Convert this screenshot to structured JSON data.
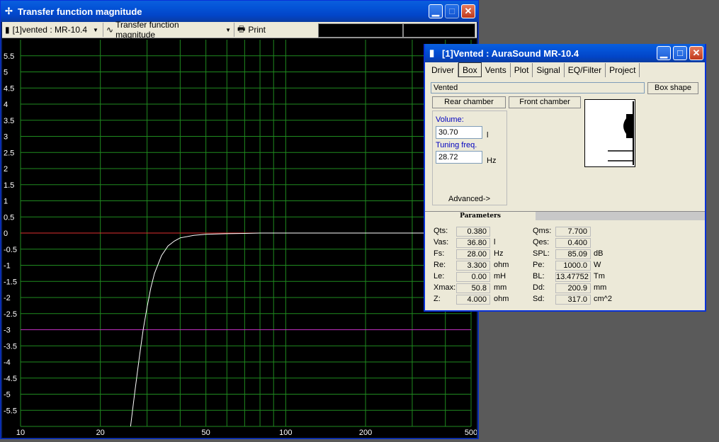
{
  "main_window": {
    "title": "Transfer function magnitude",
    "toolbar": {
      "project_select": "[1]vented : MR-10.4",
      "plot_select": "Transfer function magnitude",
      "print_label": "Print"
    }
  },
  "chart_data": {
    "type": "line",
    "x_scale": "log",
    "xlim": [
      10,
      500
    ],
    "ylim": [
      -6,
      6
    ],
    "y_ticks": [
      "5.5",
      "5",
      "4.5",
      "4",
      "3.5",
      "3",
      "2.5",
      "2",
      "1.5",
      "1",
      "0.5",
      "0",
      "-0.5",
      "-1",
      "-1.5",
      "-2",
      "-2.5",
      "-3",
      "-3.5",
      "-4",
      "-4.5",
      "-5",
      "-5.5"
    ],
    "x_tick_labels": [
      "10",
      "20",
      "50",
      "100",
      "200",
      "500"
    ],
    "grid": true,
    "reference_lines": [
      {
        "y": 0,
        "color": "#e03030"
      },
      {
        "y": -3,
        "color": "#c030c0"
      }
    ],
    "series": [
      {
        "color": "#ffffff",
        "x": [
          26,
          27,
          28,
          29,
          30,
          31,
          32,
          34,
          36,
          38,
          40,
          45,
          50,
          60,
          70,
          80,
          100,
          150,
          200,
          300,
          500
        ],
        "y": [
          -6,
          -4.9,
          -3.9,
          -3.0,
          -2.3,
          -1.7,
          -1.25,
          -0.7,
          -0.4,
          -0.25,
          -0.15,
          -0.07,
          -0.04,
          -0.02,
          -0.01,
          0,
          0,
          0,
          0,
          0,
          0
        ]
      }
    ]
  },
  "box_window": {
    "title": "[1]Vented : AuraSound MR-10.4",
    "tabs": [
      "Driver",
      "Box",
      "Vents",
      "Plot",
      "Signal",
      "EQ/Filter",
      "Project"
    ],
    "active_tab": "Box",
    "box_type": "Vented",
    "box_shape_label": "Box shape",
    "rear_chamber_label": "Rear chamber",
    "front_chamber_label": "Front chamber",
    "volume_label": "Volume:",
    "volume_value": "30.70",
    "volume_unit": "l",
    "tuning_label": "Tuning freq.",
    "tuning_value": "28.72",
    "tuning_unit": "Hz",
    "advanced_label": "Advanced->",
    "parameters_tab": "Parameters",
    "params_left": [
      {
        "name": "Qts:",
        "value": "0.380",
        "unit": ""
      },
      {
        "name": "Vas:",
        "value": "36.80",
        "unit": "l"
      },
      {
        "name": "Fs:",
        "value": "28.00",
        "unit": "Hz"
      },
      {
        "name": "Re:",
        "value": "3.300",
        "unit": "ohm"
      },
      {
        "name": "Le:",
        "value": "0.00",
        "unit": "mH"
      },
      {
        "name": "Xmax:",
        "value": "50.8",
        "unit": "mm"
      },
      {
        "name": "Z:",
        "value": "4.000",
        "unit": "ohm"
      }
    ],
    "params_right": [
      {
        "name": "Qms:",
        "value": "7.700",
        "unit": ""
      },
      {
        "name": "Qes:",
        "value": "0.400",
        "unit": ""
      },
      {
        "name": "SPL:",
        "value": "85.09",
        "unit": "dB"
      },
      {
        "name": "Pe:",
        "value": "1000.0",
        "unit": "W"
      },
      {
        "name": "BL:",
        "value": "13.47752",
        "unit": "Tm"
      },
      {
        "name": "Dd:",
        "value": "200.9",
        "unit": "mm"
      },
      {
        "name": "Sd:",
        "value": "317.0",
        "unit": "cm^2"
      }
    ]
  }
}
